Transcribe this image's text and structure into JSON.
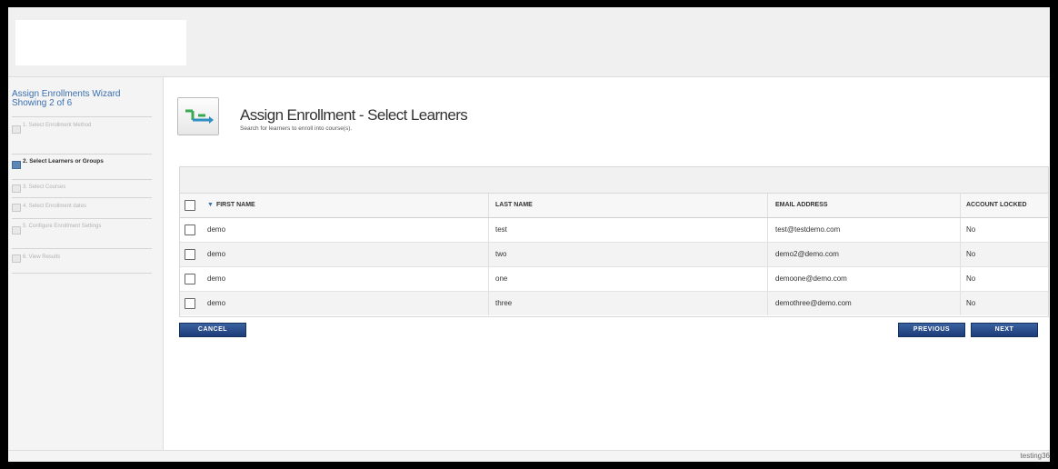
{
  "wizard": {
    "title_line1": "Assign Enrollments Wizard",
    "title_line2": "Showing 2 of 6",
    "steps": [
      {
        "label": "1. Select Enrollment Method",
        "active": false
      },
      {
        "label": "2. Select Learners or Groups",
        "active": true
      },
      {
        "label": "3. Select Courses",
        "active": false
      },
      {
        "label": "4. Select Enrollment dates",
        "active": false
      },
      {
        "label": "5. Configure Enrollment Settings",
        "active": false
      },
      {
        "label": "6. View Results",
        "active": false
      }
    ]
  },
  "page": {
    "title": "Assign Enrollment - Select Learners",
    "subtitle": "Search for learners to enroll into course(s).",
    "icon": "enrollment-icon"
  },
  "table": {
    "headers": {
      "first_name": "FIRST NAME",
      "last_name": "LAST NAME",
      "email": "EMAIL ADDRESS",
      "locked": "ACCOUNT LOCKED"
    },
    "rows": [
      {
        "first": "demo",
        "last": "test",
        "email": "test@testdemo.com",
        "locked": "No"
      },
      {
        "first": "demo",
        "last": "two",
        "email": "demo2@demo.com",
        "locked": "No"
      },
      {
        "first": "demo",
        "last": "one",
        "email": "demoone@demo.com",
        "locked": "No"
      },
      {
        "first": "demo",
        "last": "three",
        "email": "demothree@demo.com",
        "locked": "No"
      }
    ]
  },
  "buttons": {
    "cancel": "CANCEL",
    "previous": "PREVIOUS",
    "next": "NEXT"
  },
  "footer": {
    "text": "testing36"
  },
  "colors": {
    "accent_blue": "#1c3c78",
    "link_blue": "#3a6fb0"
  }
}
